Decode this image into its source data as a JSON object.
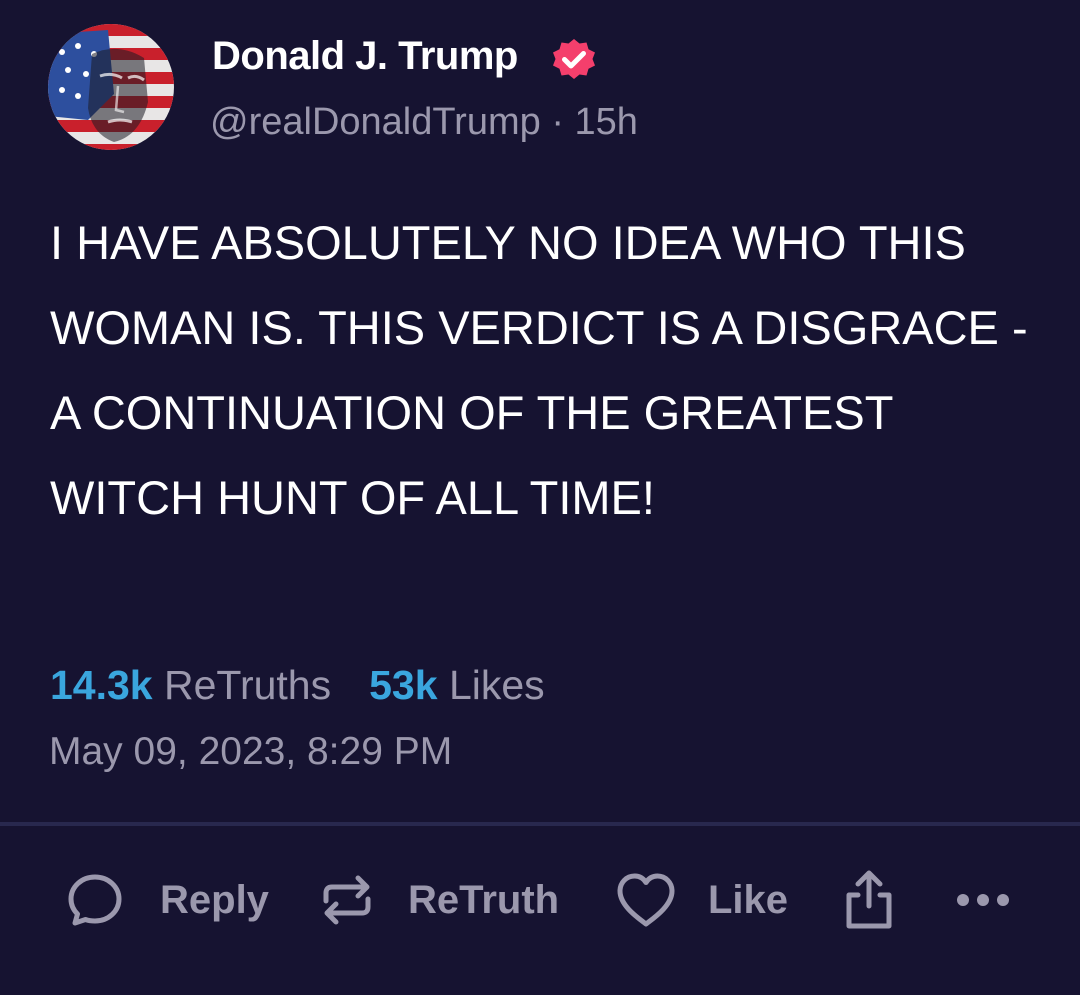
{
  "author": {
    "name": "Donald J. Trump",
    "handle": "@realDonaldTrump",
    "separator": "·",
    "age": "15h",
    "verified": true,
    "avatar_icon": "flag-portrait-avatar",
    "badge_color": "#f43f6c"
  },
  "post": {
    "text": "I HAVE ABSOLUTELY NO IDEA WHO THIS WOMAN IS. THIS VERDICT IS A DISGRACE - A CONTINUATION OF THE GREATEST WITCH HUNT OF ALL TIME!"
  },
  "stats": {
    "retruths_count": "14.3k",
    "retruths_label": "ReTruths",
    "likes_count": "53k",
    "likes_label": "Likes",
    "count_color": "#3aa6de"
  },
  "timestamp": "May 09, 2023, 8:29 PM",
  "actions": {
    "reply_label": "Reply",
    "retruth_label": "ReTruth",
    "like_label": "Like",
    "reply_icon": "speech-bubble-icon",
    "retruth_icon": "repost-arrows-icon",
    "like_icon": "heart-icon",
    "share_icon": "share-icon",
    "more_icon": "ellipsis-icon"
  },
  "colors": {
    "background": "#161331",
    "muted_text": "#9b98ad",
    "divider": "#28284e"
  }
}
